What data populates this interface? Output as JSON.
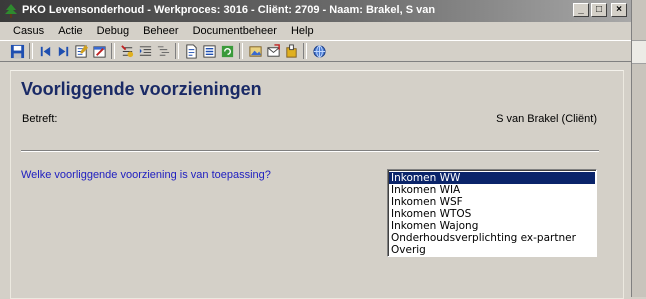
{
  "window": {
    "title": "PKO Levensonderhoud - Werkproces: 3016 - Cliënt: 2709 - Naam: Brakel, S van",
    "controls": {
      "minimize": "_",
      "maximize": "□",
      "close": "×"
    }
  },
  "menu": [
    {
      "label": "Casus"
    },
    {
      "label": "Actie"
    },
    {
      "label": "Debug"
    },
    {
      "label": "Beheer"
    },
    {
      "label": "Documentbeheer"
    },
    {
      "label": "Help"
    }
  ],
  "toolbar": {
    "icons": [
      "save-icon",
      "first-record-icon",
      "last-record-icon",
      "notes-icon",
      "edit-form-icon",
      "insert-icon",
      "indent-icon",
      "outline-icon",
      "document-icon",
      "list-icon",
      "refresh-icon",
      "image-icon",
      "send-icon",
      "archive-icon",
      "globe-icon"
    ]
  },
  "main": {
    "title": "Voorliggende voorzieningen",
    "betreft_label": "Betreft:",
    "betreft_value": "S van Brakel (Cliënt)",
    "question": "Welke voorliggende voorziening is van toepassing?",
    "options": [
      "Inkomen WW",
      "Inkomen WIA",
      "Inkomen WSF",
      "Inkomen WTOS",
      "Inkomen Wajong",
      "Onderhoudsverplichting ex-partner",
      "Overig"
    ],
    "selected_index": 0
  },
  "colors": {
    "title_text": "#1a2a66",
    "question_text": "#2020c0",
    "selection": "#0a246a",
    "background": "#d4d0c8"
  }
}
